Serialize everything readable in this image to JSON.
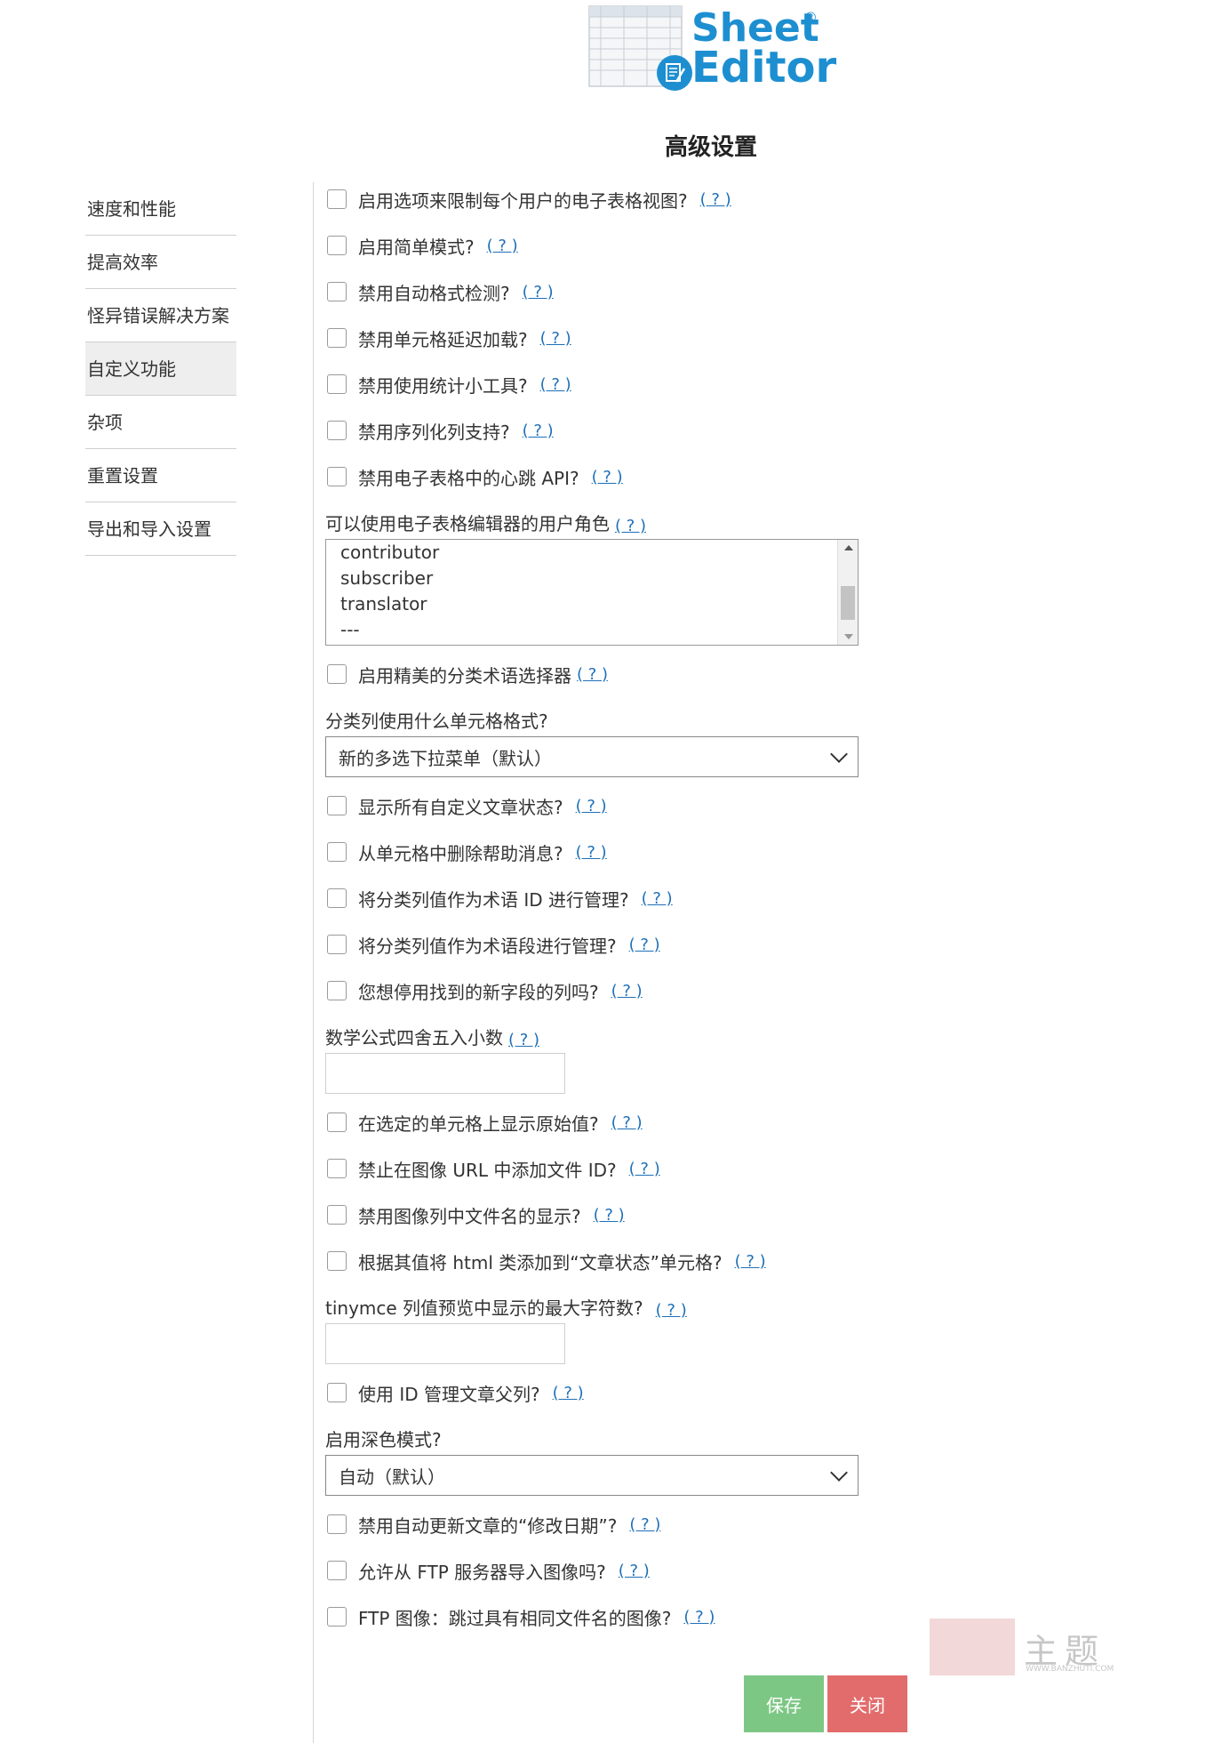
{
  "logo": {
    "line1": "Sheet",
    "line2": "Editor",
    "reg": "®"
  },
  "page_title": "高级设置",
  "sidebar": {
    "items": [
      {
        "label": "速度和性能"
      },
      {
        "label": "提高效率"
      },
      {
        "label": "怪异错误解决方案"
      },
      {
        "label": "自定义功能"
      },
      {
        "label": "杂项"
      },
      {
        "label": "重置设置"
      },
      {
        "label": "导出和导入设置"
      }
    ]
  },
  "help_label": "( ? )",
  "settings": {
    "s1": "启用选项来限制每个用户的电子表格视图?",
    "s2": "启用简单模式?",
    "s3": "禁用自动格式检测?",
    "s4": "禁用单元格延迟加载?",
    "s5": "禁用使用统计小工具?",
    "s6": "禁用序列化列支持?",
    "s7": "禁用电子表格中的心跳 API?",
    "roles_label": "可以使用电子表格编辑器的用户角色",
    "roles_options": [
      "contributor",
      "subscriber",
      "translator",
      "---"
    ],
    "s8": "启用精美的分类术语选择器",
    "cell_format_label": "分类列使用什么单元格格式?",
    "cell_format_value": "新的多选下拉菜单（默认）",
    "s9": "显示所有自定义文章状态?",
    "s10": "从单元格中删除帮助消息?",
    "s11": "将分类列值作为术语 ID 进行管理?",
    "s12": "将分类列值作为术语段进行管理?",
    "s13": "您想停用找到的新字段的列吗?",
    "decimals_label": "数学公式四舍五入小数",
    "s14": "在选定的单元格上显示原始值?",
    "s15": "禁止在图像 URL 中添加文件 ID?",
    "s16": "禁用图像列中文件名的显示?",
    "s17": "根据其值将 html 类添加到“文章状态”单元格?",
    "tinymce_label": "tinymce 列值预览中显示的最大字符数?",
    "s18": "使用 ID 管理文章父列?",
    "dark_label": "启用深色模式?",
    "dark_value": "自动（默认）",
    "s19": "禁用自动更新文章的“修改日期”?",
    "s20": "允许从 FTP 服务器导入图像吗?",
    "s21": "FTP 图像：跳过具有相同文件名的图像?"
  },
  "buttons": {
    "save": "保存",
    "close": "关闭"
  },
  "watermark": {
    "text": "主题",
    "sub": "WWW.BANZHUTI.COM"
  },
  "colors": {
    "accent": "#1d8fd1",
    "save": "#7dc785",
    "close": "#e26c6c",
    "link": "#1d6fb8"
  }
}
